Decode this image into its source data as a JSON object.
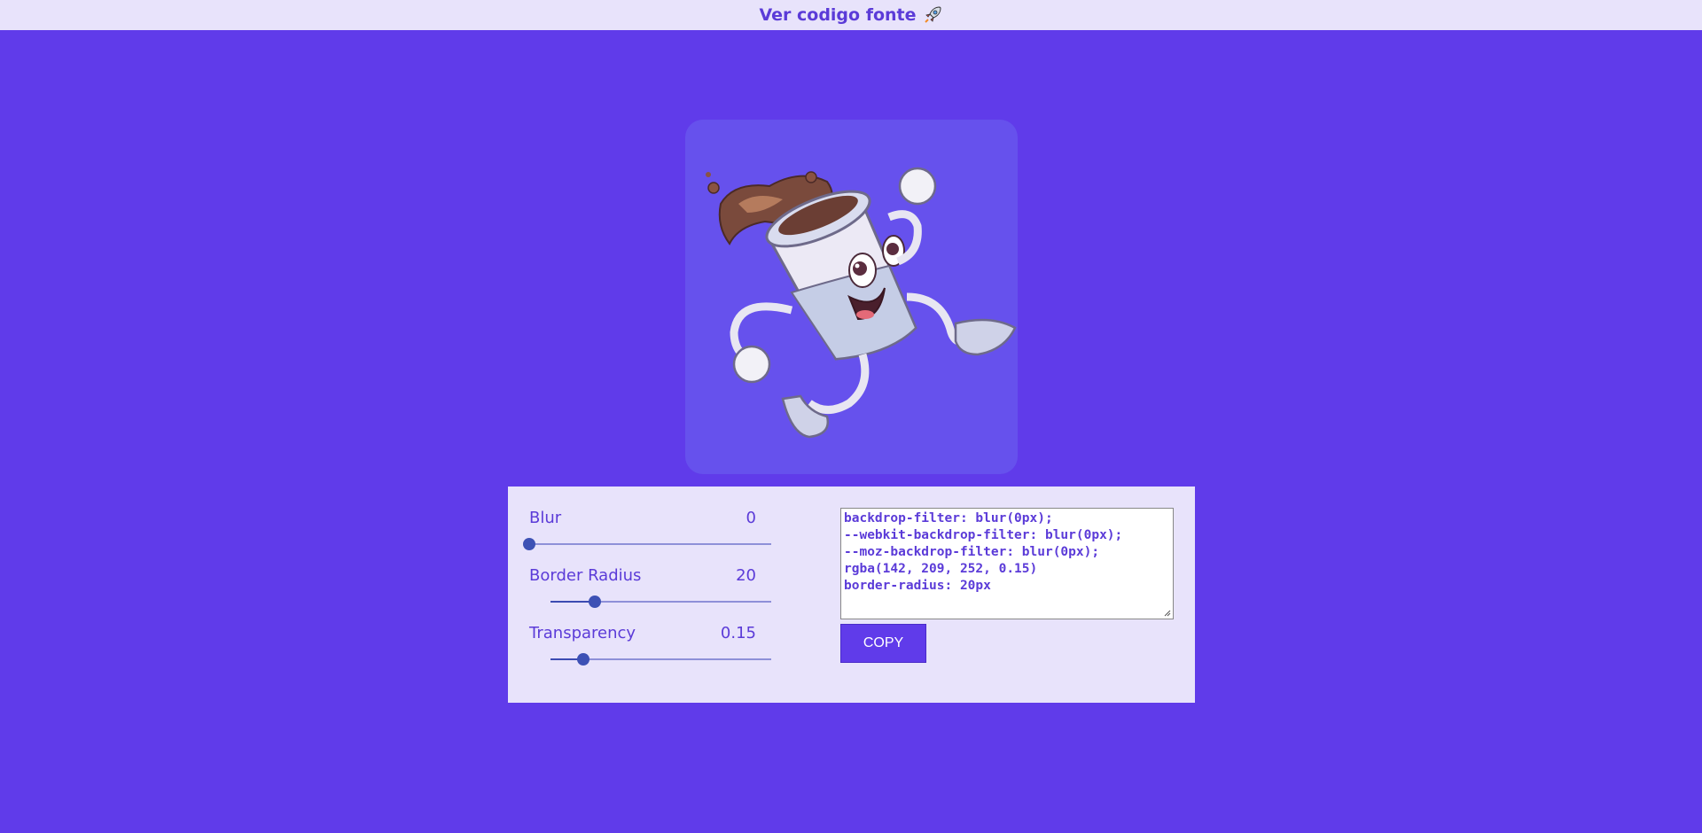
{
  "topbar": {
    "link_text": "Ver codigo fonte",
    "icon": "rocket-icon"
  },
  "controls": [
    {
      "label": "Blur",
      "value": "0",
      "level": 0.0
    },
    {
      "label": "Border Radius",
      "value": "20",
      "level": 0.2
    },
    {
      "label": "Transparency",
      "value": "0.15",
      "level": 0.15
    }
  ],
  "code_output": "backdrop-filter: blur(0px);\n--webkit-backdrop-filter: blur(0px);\n--moz-backdrop-filter: blur(0px);\nrgba(142, 209, 252, 0.15)\nborder-radius: 20px",
  "copy_button": {
    "label": "COPY"
  },
  "colors": {
    "background": "#603bea",
    "panel": "#e8e3fb",
    "accent": "#5b3bd8",
    "card": "rgba(142, 209, 252, 0.15)"
  }
}
